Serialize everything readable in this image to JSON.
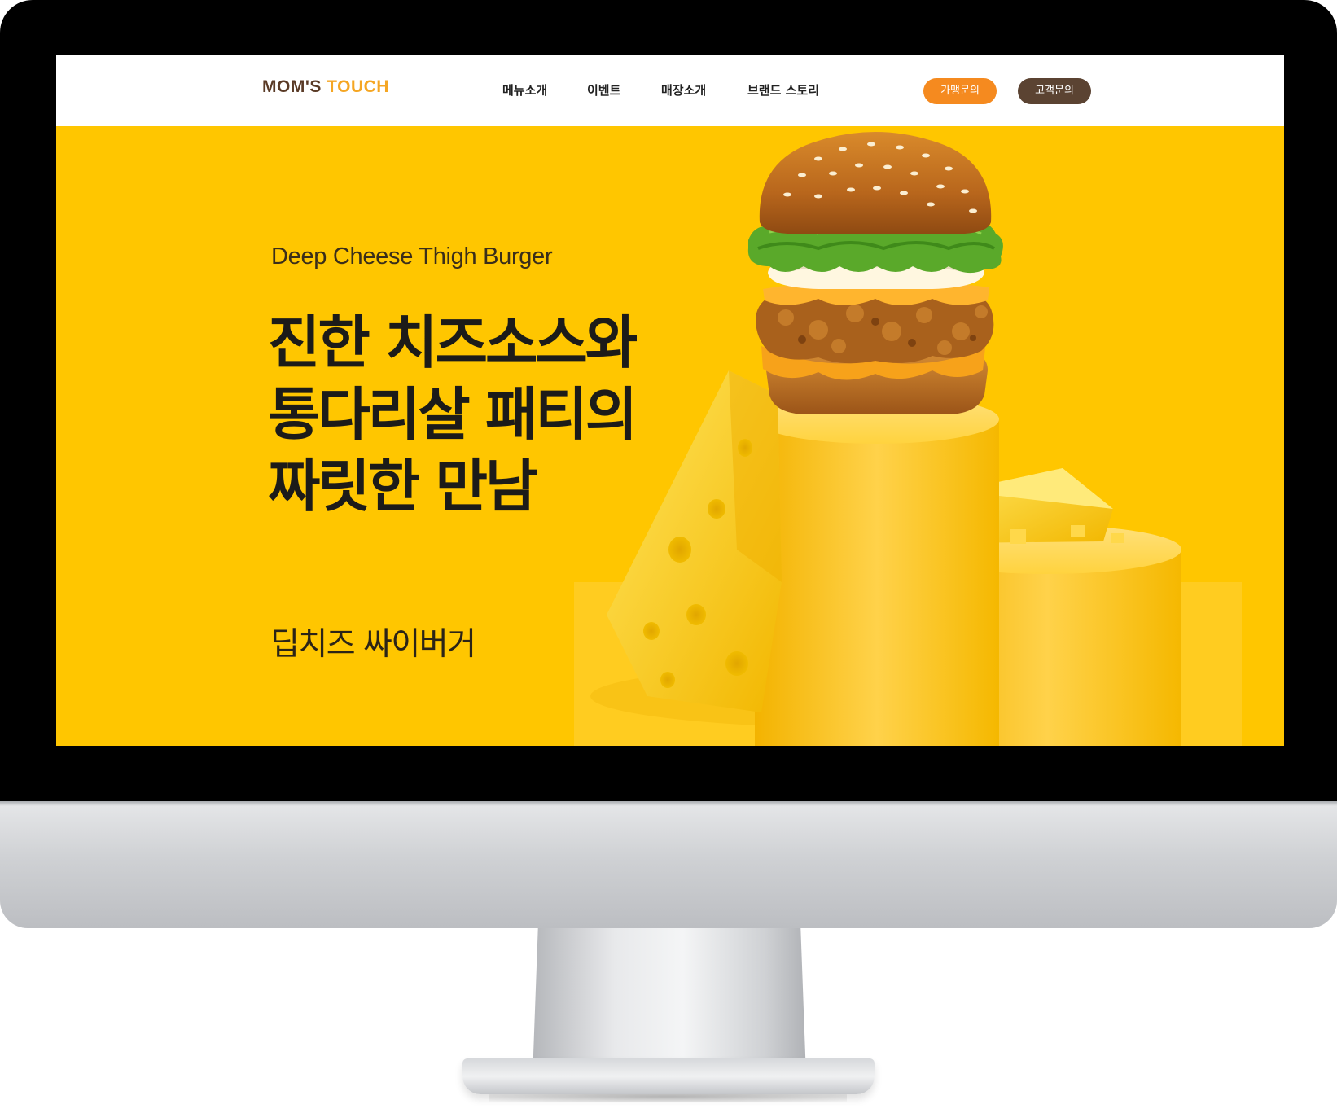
{
  "brand": {
    "logo_part1": "MOM'S",
    "logo_part2": "TOUCH",
    "logo_color_primary": "#5a3a26",
    "logo_color_accent": "#f5a623"
  },
  "nav": {
    "items": [
      {
        "label": "메뉴소개"
      },
      {
        "label": "이벤트"
      },
      {
        "label": "매장소개"
      },
      {
        "label": "브랜드 스토리"
      }
    ],
    "franchise_button": "가맹문의",
    "customer_button": "고객문의"
  },
  "hero": {
    "eyebrow": "Deep Cheese Thigh Burger",
    "headline_lines": [
      "진한 치즈소스와",
      "통다리살 패티의",
      "짜릿한 만남"
    ],
    "product_name": "딥치즈 싸이버거",
    "background_color": "#ffc600",
    "image_icon": "burger-with-cheese-illustration"
  },
  "colors": {
    "franchise_button": "#f58a1f",
    "customer_button": "#5b4332",
    "headline_text": "#1c1b19"
  }
}
